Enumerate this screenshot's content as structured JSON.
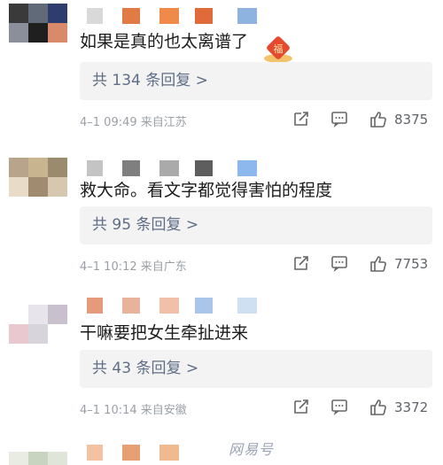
{
  "comments": [
    {
      "text": "如果是真的也太离谱了",
      "reply_label": "共 134 条回复 >",
      "time": "4–1 09:49",
      "location": "来自江苏",
      "likes": "8375",
      "avatar_colors": [
        "#3a3a3a",
        "#606a78",
        "#2e3d6e",
        "#8a8f99",
        "#1f1f1f",
        "#d88a6a"
      ],
      "name_blocks": [
        "#d9d9d9",
        "#e07b45",
        "#f08a4b",
        "#e06a3a",
        "#8fb3e0"
      ]
    },
    {
      "text": "救大命。看文字都觉得害怕的程度",
      "reply_label": "共 95 条回复 >",
      "time": "4–1 10:12",
      "location": "来自广东",
      "likes": "7753",
      "avatar_colors": [
        "#b8a48a",
        "#c8b48e",
        "#9a8a6e",
        "#e8dcc8",
        "#a08a70",
        "#d6c8b0"
      ],
      "name_blocks": [
        "#c4c4c4",
        "#7f7f7f",
        "#aaaaaa",
        "#5e5e5e",
        "#8db8ee"
      ]
    },
    {
      "text": "干嘛要把女生牵扯进来",
      "reply_label": "共 43 条回复 >",
      "time": "4–1 10:14",
      "location": "来自安徽",
      "likes": "3372",
      "avatar_colors": [
        "#ffffff",
        "#e8e4ec",
        "#c8c0cc",
        "#eac8d0",
        "#d8d4dc",
        "#ffffff"
      ],
      "name_blocks": [
        "#e59a7a",
        "#e9b29a",
        "#f0c0a8",
        "#a9c6ea",
        "#cfe0f3"
      ]
    }
  ],
  "partial_avatar_colors": [
    "#e8ece2",
    "#c8d4c0",
    "#dfe6d9"
  ],
  "partial_name_blocks": [
    "#f3c2a2",
    "#e6a073",
    "#f1b98e"
  ],
  "badge_char": "福",
  "watermark": "网易号"
}
